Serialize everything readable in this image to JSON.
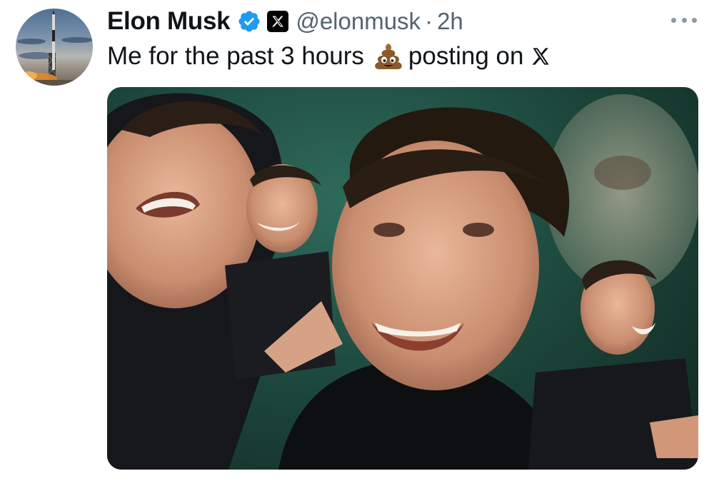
{
  "author": {
    "name": "Elon Musk",
    "handle": "@elonmusk",
    "separator": "·",
    "time": "2h"
  },
  "icons": {
    "verified": "verified-badge-icon",
    "affiliation": "x-logo-icon",
    "more": "more-options-icon",
    "emoji": "pile-of-poo-emoji"
  },
  "tweet": {
    "text_before": "Me for the past 3 hours",
    "text_after": "posting on"
  },
  "colors": {
    "verified": "#1d9bf0",
    "text": "#0f1419",
    "secondary": "#536471"
  }
}
